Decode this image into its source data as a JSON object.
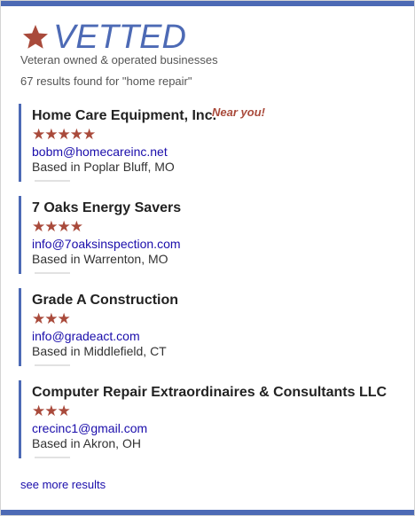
{
  "brand": {
    "name": "VETTED",
    "icon": "star-icon",
    "tagline": "Veteran owned & operated businesses"
  },
  "search": {
    "summary": "67 results found for \"home repair\""
  },
  "colors": {
    "accent": "#4d6ab5",
    "star": "#a94a3b",
    "link": "#1a0dab"
  },
  "results": [
    {
      "name": "Home Care Equipment, Inc.",
      "badge": "Near you!",
      "rating": 5,
      "stars": "★★★★★",
      "email": "bobm@homecareinc.net",
      "location": "Based in Poplar Bluff, MO"
    },
    {
      "name": "7 Oaks Energy Savers",
      "rating": 4,
      "stars": "★★★★",
      "email": "info@7oaksinspection.com",
      "location": "Based in Warrenton, MO"
    },
    {
      "name": "Grade A Construction",
      "rating": 3,
      "stars": "★★★",
      "email": "info@gradeact.com",
      "location": "Based in Middlefield, CT"
    },
    {
      "name": "Computer Repair Extraordinaires & Consultants LLC",
      "rating": 3,
      "stars": "★★★",
      "email": "crecinc1@gmail.com",
      "location": "Based in Akron, OH"
    }
  ],
  "footer": {
    "see_more": "see more results"
  }
}
